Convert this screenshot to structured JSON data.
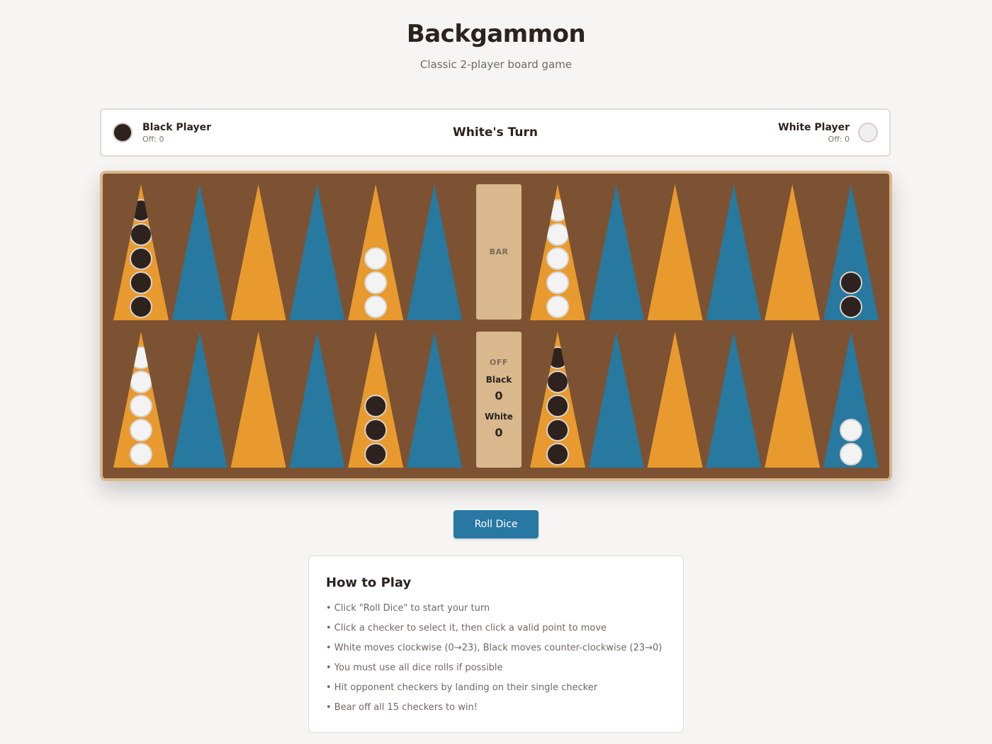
{
  "header": {
    "title": "Backgammon",
    "subtitle": "Classic 2-player board game"
  },
  "status": {
    "black_player": {
      "name": "Black Player",
      "off": "Off: 0"
    },
    "white_player": {
      "name": "White Player",
      "off": "Off: 0"
    },
    "turn": "White's Turn"
  },
  "board": {
    "bar_label": "BAR",
    "off_title": "OFF",
    "off_black_label": "Black",
    "off_black_count": "0",
    "off_white_label": "White",
    "off_white_count": "0",
    "colors": {
      "board": "#7c5233",
      "frame": "#dbb68c",
      "point_orange": "#e89a2e",
      "point_blue": "#27799f",
      "checker_black": "#2e221e",
      "checker_white": "#f3f3f3"
    },
    "top_row": [
      {
        "color": "orange",
        "checker": "black",
        "count": 5
      },
      {
        "color": "blue",
        "checker": null,
        "count": 0
      },
      {
        "color": "orange",
        "checker": null,
        "count": 0
      },
      {
        "color": "blue",
        "checker": null,
        "count": 0
      },
      {
        "color": "orange",
        "checker": "white",
        "count": 3
      },
      {
        "color": "blue",
        "checker": null,
        "count": 0
      },
      {
        "color": "orange",
        "checker": "white",
        "count": 5
      },
      {
        "color": "blue",
        "checker": null,
        "count": 0
      },
      {
        "color": "orange",
        "checker": null,
        "count": 0
      },
      {
        "color": "blue",
        "checker": null,
        "count": 0
      },
      {
        "color": "orange",
        "checker": null,
        "count": 0
      },
      {
        "color": "blue",
        "checker": "black",
        "count": 2
      }
    ],
    "bottom_row": [
      {
        "color": "orange",
        "checker": "white",
        "count": 5
      },
      {
        "color": "blue",
        "checker": null,
        "count": 0
      },
      {
        "color": "orange",
        "checker": null,
        "count": 0
      },
      {
        "color": "blue",
        "checker": null,
        "count": 0
      },
      {
        "color": "orange",
        "checker": "black",
        "count": 3
      },
      {
        "color": "blue",
        "checker": null,
        "count": 0
      },
      {
        "color": "orange",
        "checker": "black",
        "count": 5
      },
      {
        "color": "blue",
        "checker": null,
        "count": 0
      },
      {
        "color": "orange",
        "checker": null,
        "count": 0
      },
      {
        "color": "blue",
        "checker": null,
        "count": 0
      },
      {
        "color": "orange",
        "checker": null,
        "count": 0
      },
      {
        "color": "blue",
        "checker": "white",
        "count": 2
      }
    ]
  },
  "controls": {
    "roll_label": "Roll Dice"
  },
  "howto": {
    "title": "How to Play",
    "items": [
      "• Click \"Roll Dice\" to start your turn",
      "• Click a checker to select it, then click a valid point to move",
      "• White moves clockwise (0→23), Black moves counter-clockwise (23→0)",
      "• You must use all dice rolls if possible",
      "• Hit opponent checkers by landing on their single checker",
      "• Bear off all 15 checkers to win!"
    ]
  }
}
